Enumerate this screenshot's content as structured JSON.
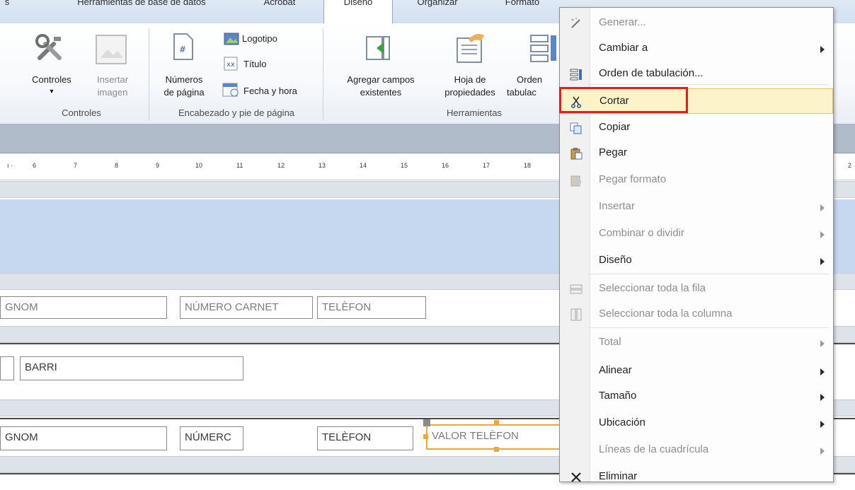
{
  "ribbon": {
    "tabs": [
      "s",
      "Herramientas de base de datos",
      "Acrobat",
      "Diseño",
      "Organizar",
      "Formato"
    ],
    "active_tab": "Diseño",
    "groups": {
      "controles": {
        "label": "Controles",
        "controles_button": "Controles",
        "insertar_imagen_1": "Insertar",
        "insertar_imagen_2": "imagen"
      },
      "encabezado": {
        "label": "Encabezado y pie de página",
        "numeros_1": "Números",
        "numeros_2": "de página",
        "logotipo": "Logotipo",
        "titulo": "Título",
        "fecha_hora": "Fecha y hora"
      },
      "herramientas": {
        "label": "Herramientas",
        "agregar_1": "Agregar campos",
        "agregar_2": "existentes",
        "hoja_1": "Hoja de",
        "hoja_2": "propiedades",
        "orden_1": "Orden",
        "orden_2": "tabulac"
      }
    }
  },
  "ruler": {
    "ticks": [
      "6",
      "7",
      "8",
      "9",
      "10",
      "11",
      "12",
      "13",
      "14",
      "15",
      "16",
      "17",
      "18"
    ],
    "right_tick": "2"
  },
  "form": {
    "header_row": {
      "gnom": "GNOM",
      "numero": "NÚMERO CARNET",
      "telefon": "TELÈFON"
    },
    "barri_row": {
      "barri": "BARRI"
    },
    "detail_row": {
      "gnom": "GNOM",
      "numero": "NÚMERC",
      "telefon": "TELÈFON",
      "valor": "VALOR TELÈFON"
    }
  },
  "context_menu": {
    "items": [
      {
        "label": "Generar...",
        "disabled": true,
        "submenu": false,
        "icon": "generate-icon"
      },
      {
        "label": "Cambiar a",
        "disabled": false,
        "submenu": true,
        "icon": ""
      },
      {
        "label": "Orden de tabulación...",
        "disabled": false,
        "submenu": false,
        "icon": "tab-order-icon"
      },
      {
        "label": "Cortar",
        "disabled": false,
        "submenu": false,
        "icon": "scissors-icon",
        "highlighted": true
      },
      {
        "label": "Copiar",
        "disabled": false,
        "submenu": false,
        "icon": "copy-icon"
      },
      {
        "label": "Pegar",
        "disabled": false,
        "submenu": false,
        "icon": "paste-icon"
      },
      {
        "label": "Pegar formato",
        "disabled": true,
        "submenu": false,
        "icon": "paste-format-icon"
      },
      {
        "label": "Insertar",
        "disabled": true,
        "submenu": true,
        "icon": ""
      },
      {
        "label": "Combinar o dividir",
        "disabled": true,
        "submenu": true,
        "icon": ""
      },
      {
        "label": "Diseño",
        "disabled": false,
        "submenu": true,
        "icon": ""
      },
      {
        "label": "Seleccionar toda la fila",
        "disabled": true,
        "submenu": false,
        "icon": "select-row-icon"
      },
      {
        "label": "Seleccionar toda la columna",
        "disabled": true,
        "submenu": false,
        "icon": "select-column-icon"
      },
      {
        "label": "Total",
        "disabled": true,
        "submenu": true,
        "icon": ""
      },
      {
        "label": "Alinear",
        "disabled": false,
        "submenu": true,
        "icon": ""
      },
      {
        "label": "Tamaño",
        "disabled": false,
        "submenu": true,
        "icon": ""
      },
      {
        "label": "Ubicación",
        "disabled": false,
        "submenu": true,
        "icon": ""
      },
      {
        "label": "Líneas de la cuadrícula",
        "disabled": true,
        "submenu": true,
        "icon": ""
      },
      {
        "label": "Eliminar",
        "disabled": false,
        "submenu": false,
        "icon": "delete-icon"
      }
    ]
  },
  "colors": {
    "highlight_box": "#e02020",
    "menu_hover": "#fdf3c9",
    "selected_control": "#f4a53a",
    "section_band": "#c5d8ef"
  }
}
